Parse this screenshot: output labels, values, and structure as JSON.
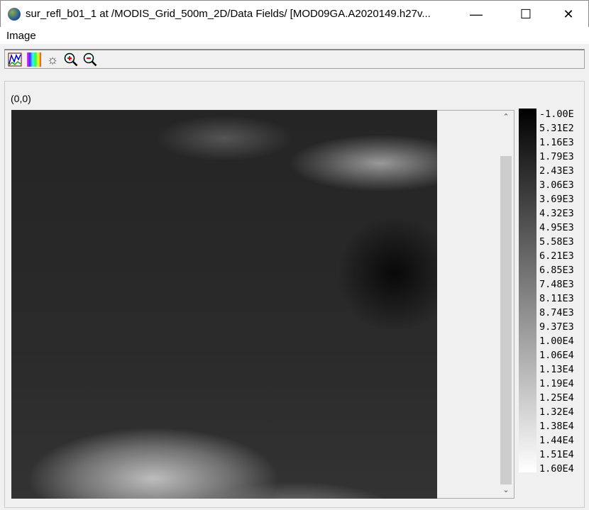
{
  "window": {
    "title": "sur_refl_b01_1  at  /MODIS_Grid_500m_2D/Data Fields/  [MOD09GA.A2020149.h27v...",
    "minimize": "—",
    "maximize": "☐",
    "close": "✕"
  },
  "menu": {
    "image": "Image"
  },
  "toolbar": [
    "histogram-icon",
    "palette-icon",
    "brightness-icon",
    "zoom-in-icon",
    "zoom-out-icon"
  ],
  "coordinate": "(0,0)",
  "colorbar": {
    "labels": [
      "-1.00E",
      "5.31E2",
      "1.16E3",
      "1.79E3",
      "2.43E3",
      "3.06E3",
      "3.69E3",
      "4.32E3",
      "4.95E3",
      "5.58E3",
      "6.21E3",
      "6.85E3",
      "7.48E3",
      "8.11E3",
      "8.74E3",
      "9.37E3",
      "1.00E4",
      "1.06E4",
      "1.13E4",
      "1.19E4",
      "1.25E4",
      "1.32E4",
      "1.38E4",
      "1.44E4",
      "1.51E4",
      "1.60E4"
    ]
  },
  "scroll": {
    "up": "⌃",
    "down": "⌄"
  }
}
